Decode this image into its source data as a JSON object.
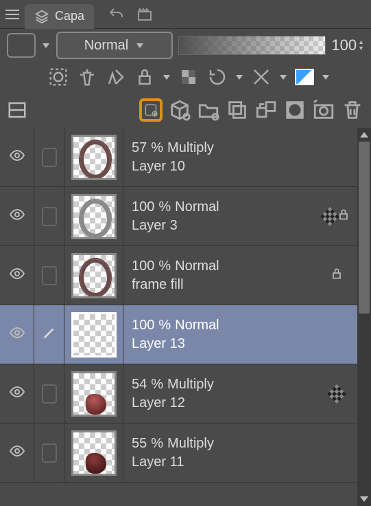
{
  "panel": {
    "tab_label": "Capa",
    "blend_mode": "Normal",
    "opacity_value": "100"
  },
  "layers": [
    {
      "opacity": "57",
      "pct": "%",
      "blend": "Multiply",
      "name": "Layer 10",
      "locked": false,
      "checker": false,
      "thumb": "frame-brown",
      "selected": false,
      "edit": false
    },
    {
      "opacity": "100",
      "pct": "%",
      "blend": "Normal",
      "name": "Layer 3",
      "locked": true,
      "checker": true,
      "thumb": "frame-grey",
      "selected": false,
      "edit": false
    },
    {
      "opacity": "100",
      "pct": "%",
      "blend": "Normal",
      "name": "frame fill",
      "locked": true,
      "checker": false,
      "thumb": "frame-brown",
      "selected": false,
      "edit": false
    },
    {
      "opacity": "100",
      "pct": "%",
      "blend": "Normal",
      "name": "Layer 13",
      "locked": false,
      "checker": false,
      "thumb": "empty",
      "selected": true,
      "edit": true
    },
    {
      "opacity": "54",
      "pct": "%",
      "blend": "Multiply",
      "name": "Layer 12",
      "locked": false,
      "checker": true,
      "thumb": "blob",
      "selected": false,
      "edit": false
    },
    {
      "opacity": "55",
      "pct": "%",
      "blend": "Multiply",
      "name": "Layer 11",
      "locked": false,
      "checker": false,
      "thumb": "blob-dark",
      "selected": false,
      "edit": false
    }
  ]
}
